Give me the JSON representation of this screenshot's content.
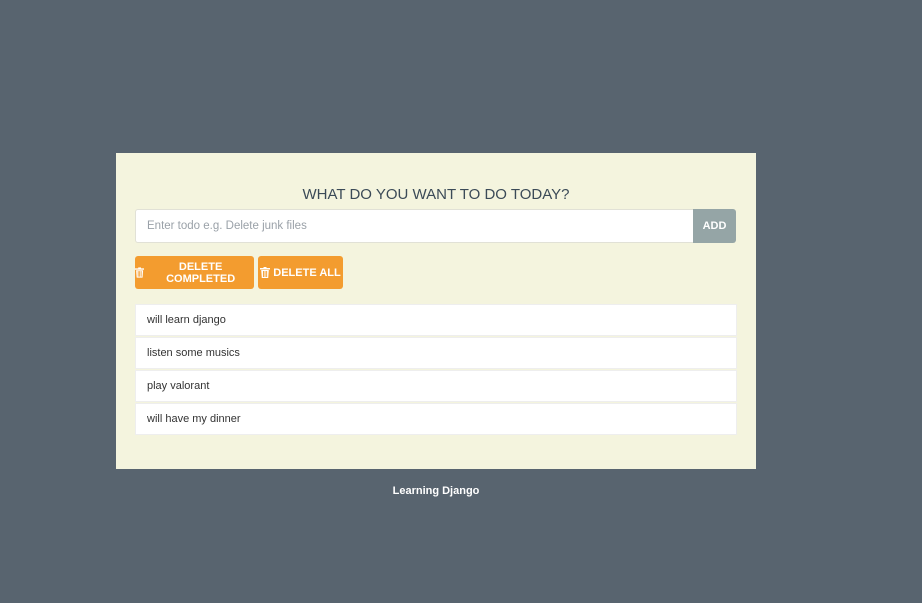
{
  "card": {
    "heading": "WHAT DO YOU WANT TO DO TODAY?",
    "todo_input": {
      "placeholder": "Enter todo e.g. Delete junk files",
      "value": ""
    },
    "add_label": "ADD",
    "actions": {
      "delete_completed_label": "DELETE COMPLETED",
      "delete_all_label": "DELETE ALL",
      "icon": "trash-icon"
    },
    "todos": [
      {
        "text": "will learn django"
      },
      {
        "text": "listen some musics"
      },
      {
        "text": "play valorant"
      },
      {
        "text": "will have my dinner"
      }
    ]
  },
  "footer": {
    "text": "Learning Django"
  },
  "colors": {
    "page_background": "#58646f",
    "card_background": "#f4f4de",
    "accent_orange": "#f39c2f",
    "add_button": "#95a5a6",
    "heading_text": "#3b4a57"
  }
}
